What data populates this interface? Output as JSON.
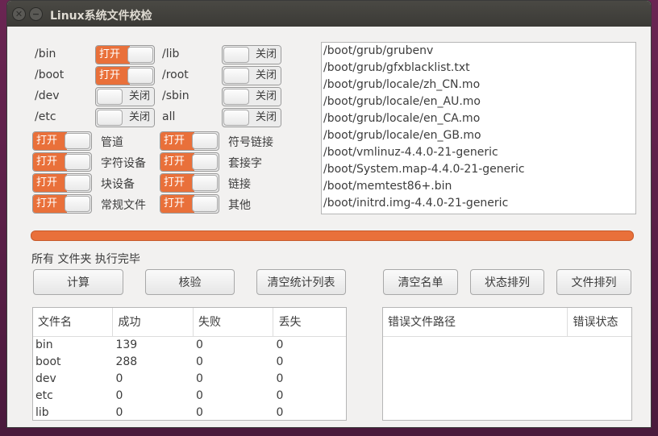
{
  "window": {
    "title": "Linux系统文件校检"
  },
  "dir_switches": [
    {
      "label": "/bin",
      "on": true
    },
    {
      "label": "/boot",
      "on": true
    },
    {
      "label": "/dev",
      "on": false
    },
    {
      "label": "/etc",
      "on": false
    },
    {
      "label": "/lib",
      "on": false
    },
    {
      "label": "/root",
      "on": false
    },
    {
      "label": "/sbin",
      "on": false
    },
    {
      "label": "all",
      "on": false
    }
  ],
  "type_switches": [
    {
      "label": "管道",
      "on": true
    },
    {
      "label": "字符设备",
      "on": true
    },
    {
      "label": "块设备",
      "on": true
    },
    {
      "label": "常规文件",
      "on": true
    },
    {
      "label": "符号链接",
      "on": true
    },
    {
      "label": "套接字",
      "on": true
    },
    {
      "label": "链接",
      "on": true
    },
    {
      "label": "其他",
      "on": true
    }
  ],
  "switch_text": {
    "on": "打开",
    "off": "关闭"
  },
  "file_list": [
    "/boot/grub/grubenv",
    "/boot/grub/gfxblacklist.txt",
    "/boot/grub/locale/zh_CN.mo",
    "/boot/grub/locale/en_AU.mo",
    "/boot/grub/locale/en_CA.mo",
    "/boot/grub/locale/en_GB.mo",
    "/boot/vmlinuz-4.4.0-21-generic",
    "/boot/System.map-4.4.0-21-generic",
    "/boot/memtest86+.bin",
    "/boot/initrd.img-4.4.0-21-generic"
  ],
  "progress": {
    "percent": 100
  },
  "status_text": "所有 文件夹 执行完毕",
  "buttons": {
    "compute": "计算",
    "verify": "核验",
    "clear_stats": "清空统计列表",
    "clear_list": "清空名单",
    "sort_status": "状态排列",
    "sort_file": "文件排列"
  },
  "stats_table": {
    "headers": [
      "文件名",
      "成功",
      "失败",
      "丢失"
    ],
    "rows": [
      [
        "bin",
        "139",
        "0",
        "0"
      ],
      [
        "boot",
        "288",
        "0",
        "0"
      ],
      [
        "dev",
        "0",
        "0",
        "0"
      ],
      [
        "etc",
        "0",
        "0",
        "0"
      ],
      [
        "lib",
        "0",
        "0",
        "0"
      ]
    ]
  },
  "error_table": {
    "headers": [
      "错误文件路径",
      "错误状态"
    ]
  },
  "colors": {
    "accent": "#e9703a",
    "titlebar": "#3c3b37"
  }
}
